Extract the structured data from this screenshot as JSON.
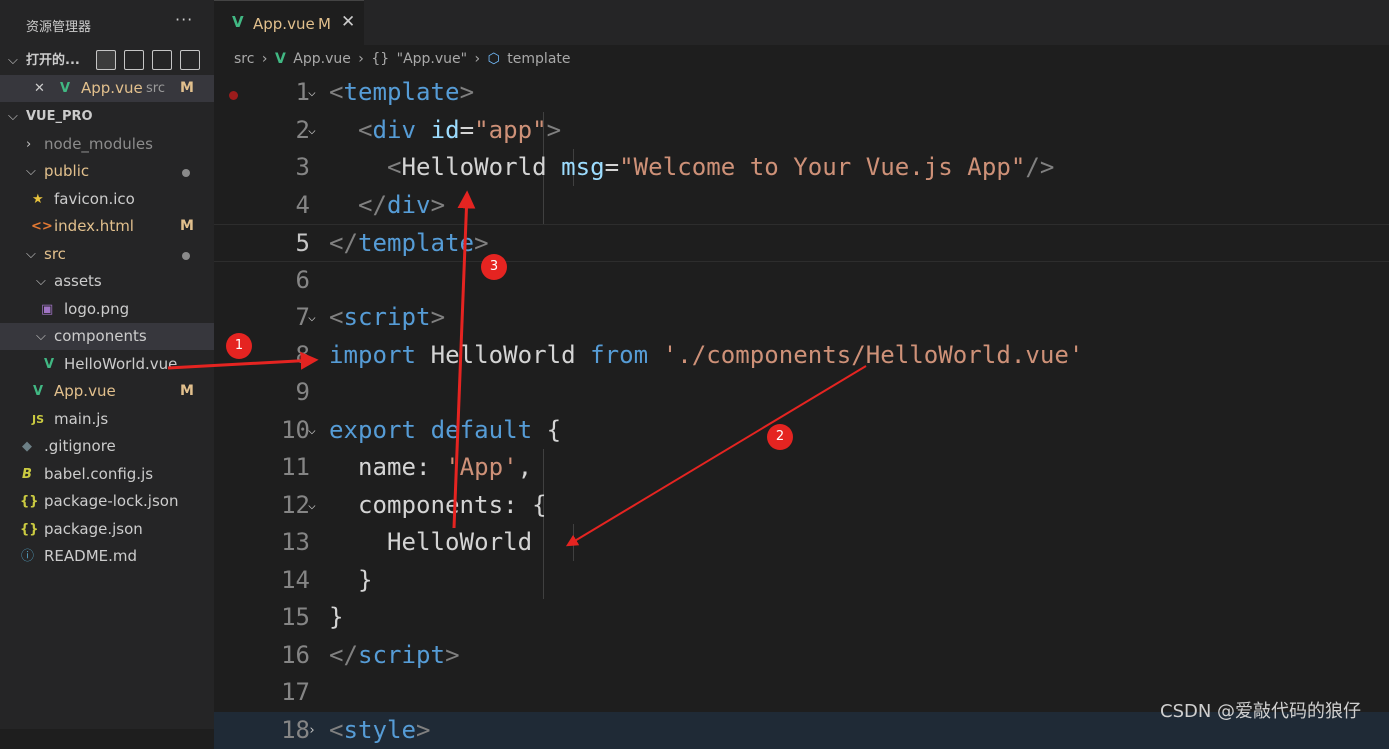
{
  "sidebar": {
    "title": "资源管理器",
    "more": "···",
    "open_editors": {
      "label": "打开的...",
      "item": {
        "name": "App.vue",
        "folder": "src",
        "badge": "M"
      }
    },
    "project": "VUE_PRO",
    "tree": [
      {
        "label": "node_modules",
        "badge": ""
      },
      {
        "label": "public",
        "badge": ""
      },
      {
        "label": "favicon.ico",
        "badge": ""
      },
      {
        "label": "index.html",
        "badge": "M"
      },
      {
        "label": "src",
        "badge": ""
      },
      {
        "label": "assets",
        "badge": ""
      },
      {
        "label": "logo.png",
        "badge": ""
      },
      {
        "label": "components",
        "badge": ""
      },
      {
        "label": "HelloWorld.vue",
        "badge": ""
      },
      {
        "label": "App.vue",
        "badge": "M"
      },
      {
        "label": "main.js",
        "badge": ""
      },
      {
        "label": ".gitignore",
        "badge": ""
      },
      {
        "label": "babel.config.js",
        "badge": ""
      },
      {
        "label": "package-lock.json",
        "badge": ""
      },
      {
        "label": "package.json",
        "badge": ""
      },
      {
        "label": "README.md",
        "badge": ""
      }
    ]
  },
  "tab": {
    "name": "App.vue",
    "badge": "M",
    "close": "✕"
  },
  "breadcrumb": {
    "src": "src",
    "file": "App.vue",
    "symbol": "\"App.vue\"",
    "node": "template"
  },
  "editor": {
    "line_numbers": [
      "1",
      "2",
      "3",
      "4",
      "5",
      "6",
      "7",
      "8",
      "9",
      "10",
      "11",
      "12",
      "13",
      "14",
      "15",
      "16",
      "17",
      "18"
    ],
    "tokens": {
      "template": "template",
      "div": "div",
      "id_attr": "id",
      "app_str": "\"app\"",
      "hello_tag": "HelloWorld",
      "msg_attr": "msg",
      "msg_str": "\"Welcome to Your Vue.js App\"",
      "script": "script",
      "import": "import",
      "hello_ident": "HelloWorld",
      "from": "from",
      "path_str": "'./components/HelloWorld.vue'",
      "export": "export",
      "default": "default",
      "name_prop": "name",
      "app_name": "'App'",
      "components_prop": "components",
      "hello_entry": "HelloWorld",
      "style": "style"
    }
  },
  "annotations": [
    "1",
    "2",
    "3"
  ],
  "watermark": "CSDN @爱敲代码的狼仔",
  "colors": {
    "vue_icon": "#41b883",
    "modified": "#e2c08d",
    "annotation": "#e52421",
    "background": "#1e1e1e"
  }
}
